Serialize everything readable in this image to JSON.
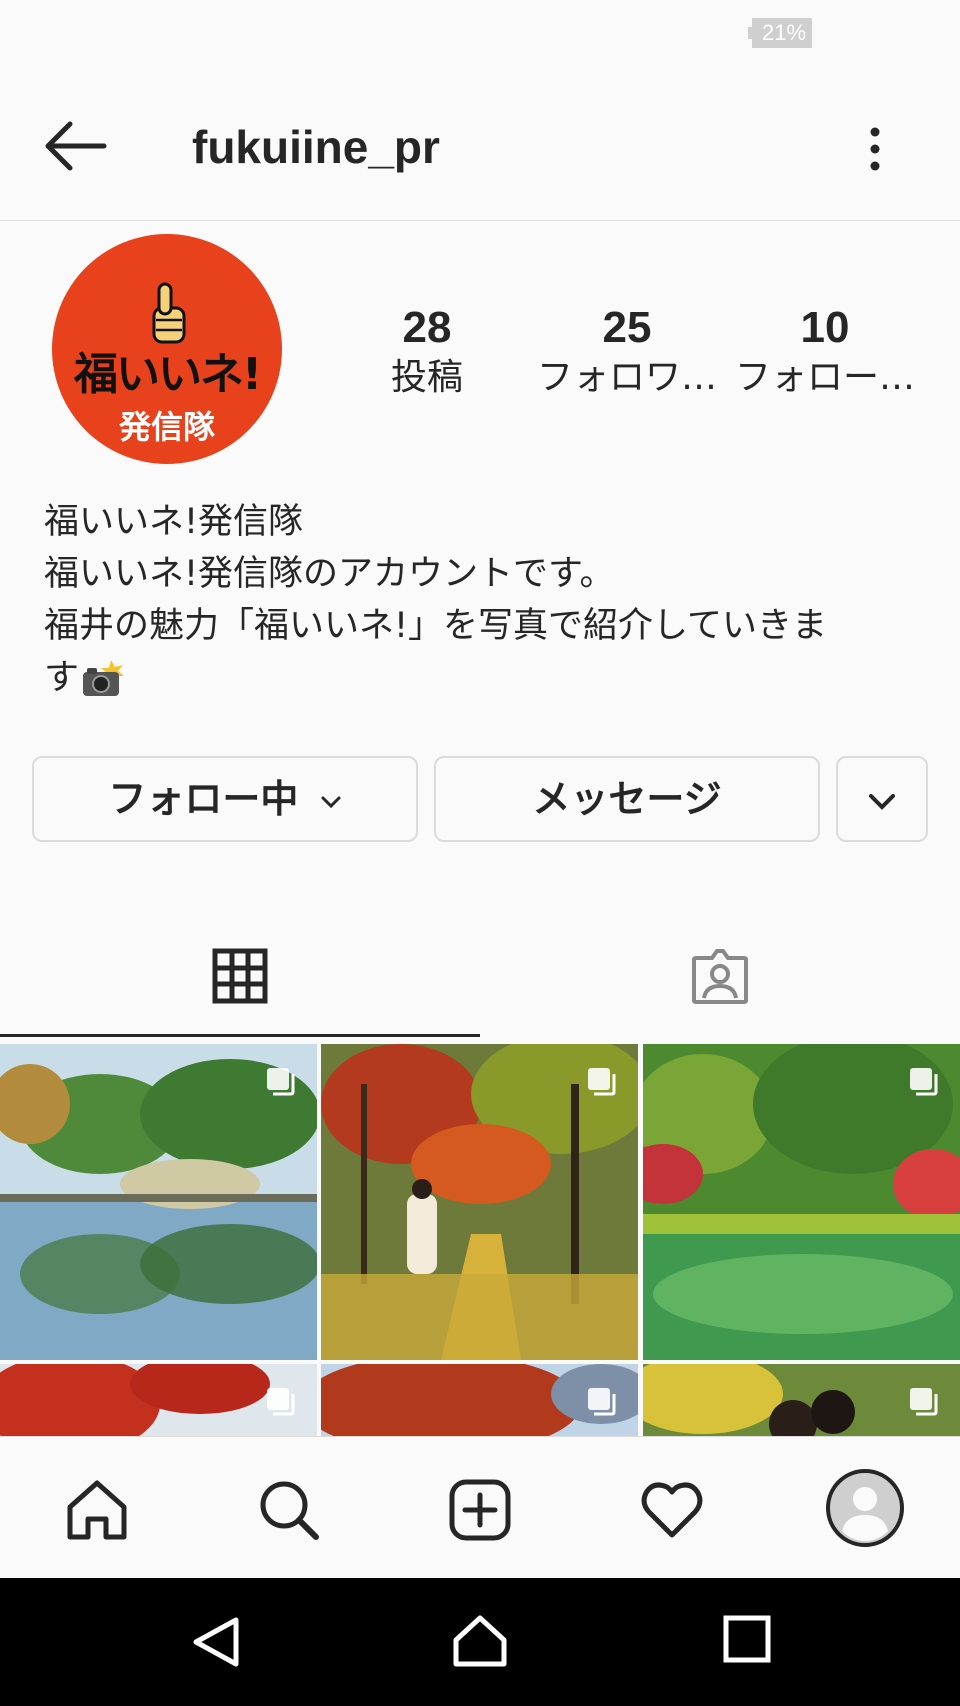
{
  "status_bar": {
    "battery": "21%"
  },
  "header": {
    "username": "fukuiine_pr"
  },
  "profile": {
    "avatar_logo_text": "福いいネ!",
    "avatar_sub_text": "発信隊",
    "stats": [
      {
        "count": "28",
        "label": "投稿"
      },
      {
        "count": "25",
        "label": "フォロワ…"
      },
      {
        "count": "10",
        "label": "フォロー…"
      }
    ],
    "bio": {
      "name": "福いいネ!発信隊",
      "line1": "福いいネ!発信隊のアカウントです。",
      "line2": "福井の魅力「福いいネ!」を写真で紹介していきま",
      "line3": "す"
    }
  },
  "actions": {
    "following_label": "フォロー中",
    "message_label": "メッセージ"
  },
  "tabs": [
    {
      "icon": "grid-icon",
      "active": true
    },
    {
      "icon": "tagged-icon",
      "active": false
    }
  ],
  "posts": [
    {
      "scene": "garden pond reflection"
    },
    {
      "scene": "autumn path with walker"
    },
    {
      "scene": "green pond red maples"
    },
    {
      "scene": "red maple leaves"
    },
    {
      "scene": "autumn branches sky"
    },
    {
      "scene": "yellow leaves people"
    }
  ],
  "bottom_nav": [
    "home-icon",
    "search-icon",
    "new-post-icon",
    "activity-heart-icon",
    "profile-avatar-icon"
  ],
  "colors": {
    "brand_red": "#e8421c",
    "text": "#262626",
    "border": "#dbdbdb"
  }
}
